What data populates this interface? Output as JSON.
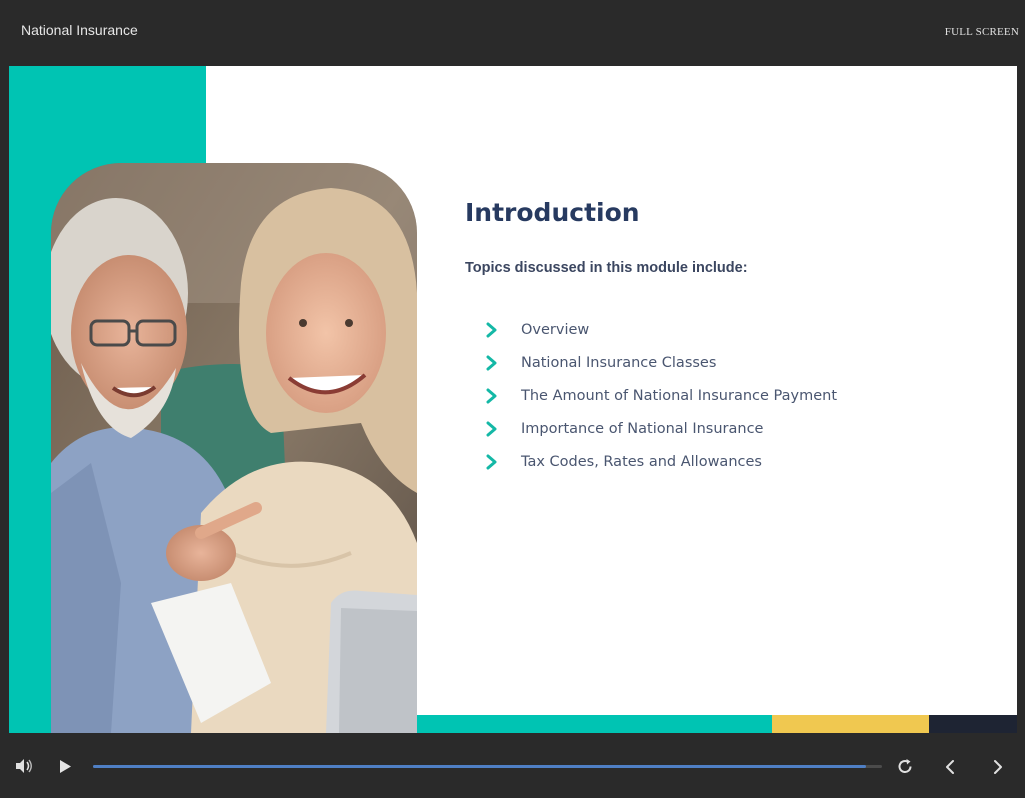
{
  "header": {
    "title": "National Insurance",
    "fullscreen_label": "FULL SCREEN"
  },
  "slide": {
    "heading": "Introduction",
    "subheading": "Topics discussed in this module include:",
    "topics": [
      "Overview",
      "National Insurance Classes",
      "The Amount of National Insurance Payment",
      "Importance of National Insurance",
      "Tax Codes, Rates and Allowances"
    ],
    "photo_icon": "photo-senior-couple"
  },
  "player": {
    "progress_fraction": 0.98,
    "icons": [
      "volume-icon",
      "play-icon",
      "replay-icon",
      "previous-icon",
      "next-icon"
    ]
  },
  "colors": {
    "teal": "#00c4b3",
    "yellow": "#f0c850",
    "navy": "#1e2433",
    "heading": "#273a60",
    "progress": "#4f7fc4"
  }
}
